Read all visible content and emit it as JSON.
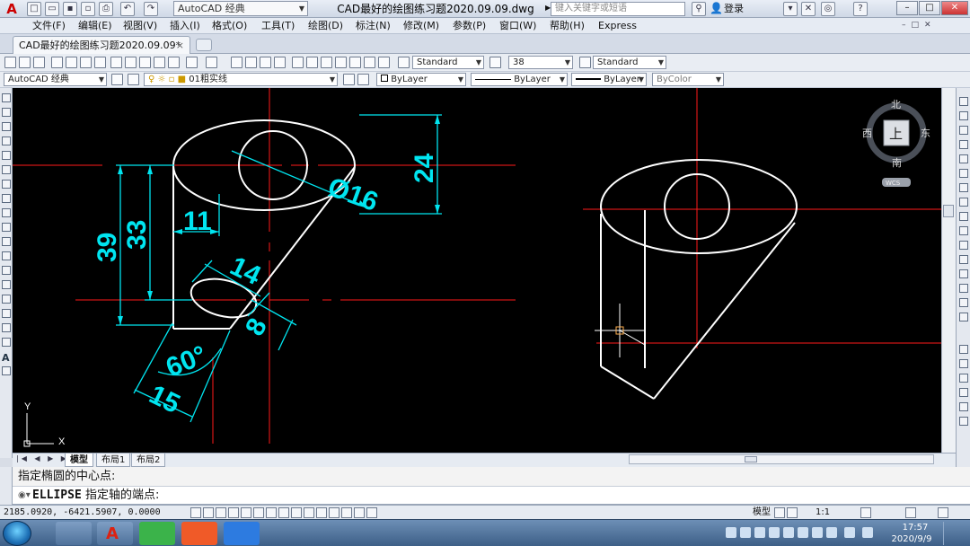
{
  "titlebar": {
    "workspace": "AutoCAD 经典",
    "doc_title": "CAD最好的绘图练习题2020.09.09.dwg",
    "search_placeholder": "键入关键字或短语",
    "login": "登录"
  },
  "menu": [
    "文件(F)",
    "编辑(E)",
    "视图(V)",
    "插入(I)",
    "格式(O)",
    "工具(T)",
    "绘图(D)",
    "标注(N)",
    "修改(M)",
    "参数(P)",
    "窗口(W)",
    "帮助(H)",
    "Express"
  ],
  "doc_tab": {
    "label": "CAD最好的绘图练习题2020.09.09*",
    "close": "×"
  },
  "toolbar1": {
    "text_style": "Standard",
    "text_height": "38",
    "dim_style": "Standard"
  },
  "toolbar2": {
    "workspace": "AutoCAD 经典",
    "layer": "01粗实线",
    "color": "ByLayer",
    "linetype": "ByLayer",
    "lineweight": "ByLayer",
    "plotstyle": "ByColor"
  },
  "viewcube": {
    "north": "北",
    "south": "南",
    "east": "东",
    "west": "西",
    "top": "上",
    "wcs": "WCS"
  },
  "dimensions": {
    "d16": "Ø16",
    "d24": "24",
    "d11": "11",
    "d33": "33",
    "d39": "39",
    "d14": "14",
    "d8": "8",
    "d60": "60°",
    "d15": "15"
  },
  "ucs": {
    "x": "X",
    "y": "Y"
  },
  "layout_tabs": [
    "模型",
    "布局1",
    "布局2"
  ],
  "command": {
    "history": "指定椭圆的中心点:",
    "current_keyword": "ELLIPSE",
    "current_prompt": "指定轴的端点:"
  },
  "status": {
    "coords": "2185.0920, -6421.5907, 0.0000",
    "model": "模型",
    "scale": "1:1"
  },
  "taskbar": {
    "time": "17:57",
    "date": "2020/9/9"
  },
  "colors": {
    "drawing_bg": "#000000",
    "geometry": "#ffffff",
    "dimension": "#00e5f0",
    "center_line": "#ff1a1a",
    "cursor": "#ffb050"
  }
}
